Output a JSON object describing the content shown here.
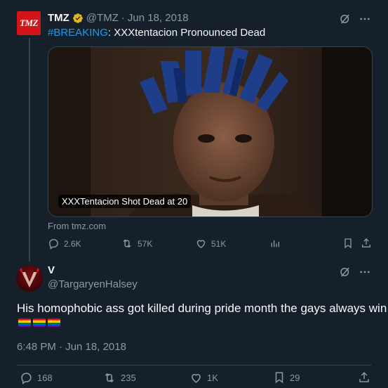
{
  "parent_tweet": {
    "avatar_text": "TMZ",
    "name": "TMZ",
    "handle": "@TMZ",
    "separator": "·",
    "date": "Jun 18, 2018",
    "hashtag": "#BREAKING",
    "text": ": XXXtentacion Pronounced Dead",
    "card_caption": "XXXTentacion Shot Dead at 20",
    "card_source": "From tmz.com",
    "replies": "2.6K",
    "reposts": "57K",
    "likes": "51K"
  },
  "main_tweet": {
    "name": "V",
    "handle": "@TargaryenHalsey",
    "text": "His homophobic ass got killed during pride month the gays always win",
    "flags": [
      "🏳️‍🌈",
      "🏳️‍🌈",
      "🏳️‍🌈"
    ],
    "timestamp": "6:48 PM · Jun 18, 2018",
    "replies": "168",
    "reposts": "235",
    "likes": "1K",
    "bookmarks": "29"
  },
  "colors": {
    "background": "#15202b",
    "accent": "#1d9bf0",
    "muted": "#8b98a5",
    "verified_gold": "#e2b719",
    "tmz_red": "#d4141b"
  }
}
